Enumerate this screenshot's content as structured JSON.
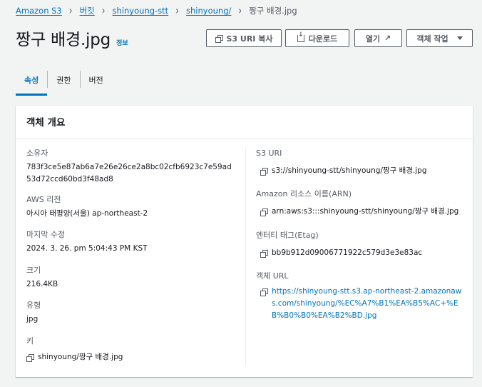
{
  "breadcrumb": [
    "Amazon S3",
    "버킷",
    "shinyoung-stt",
    "shinyoung/",
    "짱구 배경.jpg"
  ],
  "title": "짱구 배경.jpg",
  "info": "정보",
  "actions": {
    "copy_uri": "S3 URI 복사",
    "download": "다운로드",
    "open": "열기",
    "object_actions": "객체 작업"
  },
  "tabs": [
    "속성",
    "권한",
    "버전"
  ],
  "panel": {
    "heading": "객체 개요",
    "owner_label": "소유자",
    "owner_value": "783f3ce5e87ab6a7e26e26ce2a8bc02cfb6923c7e59ad53d72ccd60bd3f48ad8",
    "region_label": "AWS 리전",
    "region_value": "아시아 태평양(서울) ap-northeast-2",
    "modified_label": "마지막 수정",
    "modified_value": "2024. 3. 26. pm 5:04:43 PM KST",
    "size_label": "크기",
    "size_value": "216.4KB",
    "type_label": "유형",
    "type_value": "jpg",
    "key_label": "키",
    "key_value": "shinyoung/짱구 배경.jpg",
    "s3uri_label": "S3 URI",
    "s3uri_value": "s3://shinyoung-stt/shinyoung/짱구 배경.jpg",
    "arn_label": "Amazon 리소스 이름(ARN)",
    "arn_value": "arn:aws:s3:::shinyoung-stt/shinyoung/짱구 배경.jpg",
    "etag_label": "엔터티 태그(Etag)",
    "etag_value": "bb9b912d09006771922c579d3e3e83ac",
    "url_label": "객체 URL",
    "url_value": "https://shinyoung-stt.s3.ap-northeast-2.amazonaws.com/shinyoung/%EC%A7%B1%EA%B5%AC+%EB%B0%B0%EA%B2%BD.jpg"
  }
}
